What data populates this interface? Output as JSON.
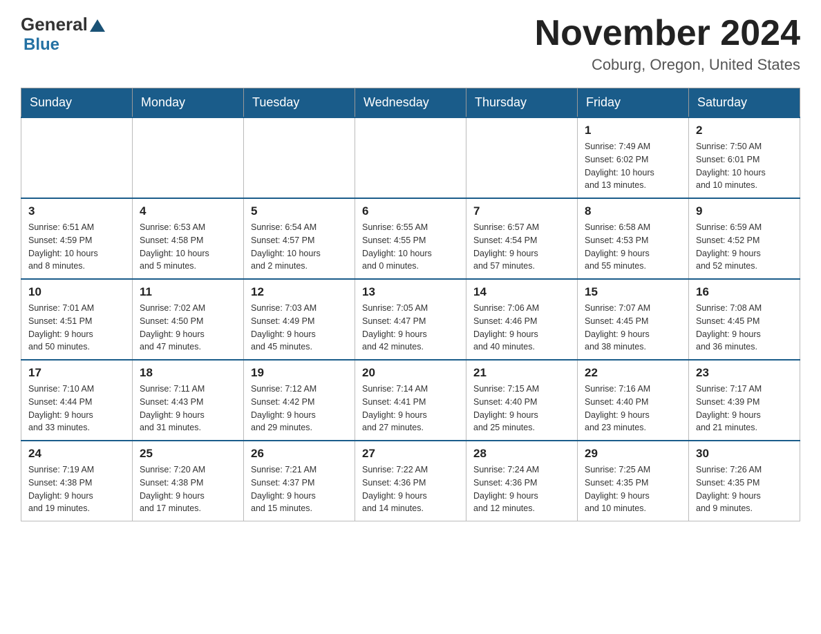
{
  "header": {
    "logo_general": "General",
    "logo_blue": "Blue",
    "month_year": "November 2024",
    "location": "Coburg, Oregon, United States"
  },
  "days_of_week": [
    "Sunday",
    "Monday",
    "Tuesday",
    "Wednesday",
    "Thursday",
    "Friday",
    "Saturday"
  ],
  "weeks": [
    [
      {
        "day": "",
        "info": ""
      },
      {
        "day": "",
        "info": ""
      },
      {
        "day": "",
        "info": ""
      },
      {
        "day": "",
        "info": ""
      },
      {
        "day": "",
        "info": ""
      },
      {
        "day": "1",
        "info": "Sunrise: 7:49 AM\nSunset: 6:02 PM\nDaylight: 10 hours\nand 13 minutes."
      },
      {
        "day": "2",
        "info": "Sunrise: 7:50 AM\nSunset: 6:01 PM\nDaylight: 10 hours\nand 10 minutes."
      }
    ],
    [
      {
        "day": "3",
        "info": "Sunrise: 6:51 AM\nSunset: 4:59 PM\nDaylight: 10 hours\nand 8 minutes."
      },
      {
        "day": "4",
        "info": "Sunrise: 6:53 AM\nSunset: 4:58 PM\nDaylight: 10 hours\nand 5 minutes."
      },
      {
        "day": "5",
        "info": "Sunrise: 6:54 AM\nSunset: 4:57 PM\nDaylight: 10 hours\nand 2 minutes."
      },
      {
        "day": "6",
        "info": "Sunrise: 6:55 AM\nSunset: 4:55 PM\nDaylight: 10 hours\nand 0 minutes."
      },
      {
        "day": "7",
        "info": "Sunrise: 6:57 AM\nSunset: 4:54 PM\nDaylight: 9 hours\nand 57 minutes."
      },
      {
        "day": "8",
        "info": "Sunrise: 6:58 AM\nSunset: 4:53 PM\nDaylight: 9 hours\nand 55 minutes."
      },
      {
        "day": "9",
        "info": "Sunrise: 6:59 AM\nSunset: 4:52 PM\nDaylight: 9 hours\nand 52 minutes."
      }
    ],
    [
      {
        "day": "10",
        "info": "Sunrise: 7:01 AM\nSunset: 4:51 PM\nDaylight: 9 hours\nand 50 minutes."
      },
      {
        "day": "11",
        "info": "Sunrise: 7:02 AM\nSunset: 4:50 PM\nDaylight: 9 hours\nand 47 minutes."
      },
      {
        "day": "12",
        "info": "Sunrise: 7:03 AM\nSunset: 4:49 PM\nDaylight: 9 hours\nand 45 minutes."
      },
      {
        "day": "13",
        "info": "Sunrise: 7:05 AM\nSunset: 4:47 PM\nDaylight: 9 hours\nand 42 minutes."
      },
      {
        "day": "14",
        "info": "Sunrise: 7:06 AM\nSunset: 4:46 PM\nDaylight: 9 hours\nand 40 minutes."
      },
      {
        "day": "15",
        "info": "Sunrise: 7:07 AM\nSunset: 4:45 PM\nDaylight: 9 hours\nand 38 minutes."
      },
      {
        "day": "16",
        "info": "Sunrise: 7:08 AM\nSunset: 4:45 PM\nDaylight: 9 hours\nand 36 minutes."
      }
    ],
    [
      {
        "day": "17",
        "info": "Sunrise: 7:10 AM\nSunset: 4:44 PM\nDaylight: 9 hours\nand 33 minutes."
      },
      {
        "day": "18",
        "info": "Sunrise: 7:11 AM\nSunset: 4:43 PM\nDaylight: 9 hours\nand 31 minutes."
      },
      {
        "day": "19",
        "info": "Sunrise: 7:12 AM\nSunset: 4:42 PM\nDaylight: 9 hours\nand 29 minutes."
      },
      {
        "day": "20",
        "info": "Sunrise: 7:14 AM\nSunset: 4:41 PM\nDaylight: 9 hours\nand 27 minutes."
      },
      {
        "day": "21",
        "info": "Sunrise: 7:15 AM\nSunset: 4:40 PM\nDaylight: 9 hours\nand 25 minutes."
      },
      {
        "day": "22",
        "info": "Sunrise: 7:16 AM\nSunset: 4:40 PM\nDaylight: 9 hours\nand 23 minutes."
      },
      {
        "day": "23",
        "info": "Sunrise: 7:17 AM\nSunset: 4:39 PM\nDaylight: 9 hours\nand 21 minutes."
      }
    ],
    [
      {
        "day": "24",
        "info": "Sunrise: 7:19 AM\nSunset: 4:38 PM\nDaylight: 9 hours\nand 19 minutes."
      },
      {
        "day": "25",
        "info": "Sunrise: 7:20 AM\nSunset: 4:38 PM\nDaylight: 9 hours\nand 17 minutes."
      },
      {
        "day": "26",
        "info": "Sunrise: 7:21 AM\nSunset: 4:37 PM\nDaylight: 9 hours\nand 15 minutes."
      },
      {
        "day": "27",
        "info": "Sunrise: 7:22 AM\nSunset: 4:36 PM\nDaylight: 9 hours\nand 14 minutes."
      },
      {
        "day": "28",
        "info": "Sunrise: 7:24 AM\nSunset: 4:36 PM\nDaylight: 9 hours\nand 12 minutes."
      },
      {
        "day": "29",
        "info": "Sunrise: 7:25 AM\nSunset: 4:35 PM\nDaylight: 9 hours\nand 10 minutes."
      },
      {
        "day": "30",
        "info": "Sunrise: 7:26 AM\nSunset: 4:35 PM\nDaylight: 9 hours\nand 9 minutes."
      }
    ]
  ]
}
